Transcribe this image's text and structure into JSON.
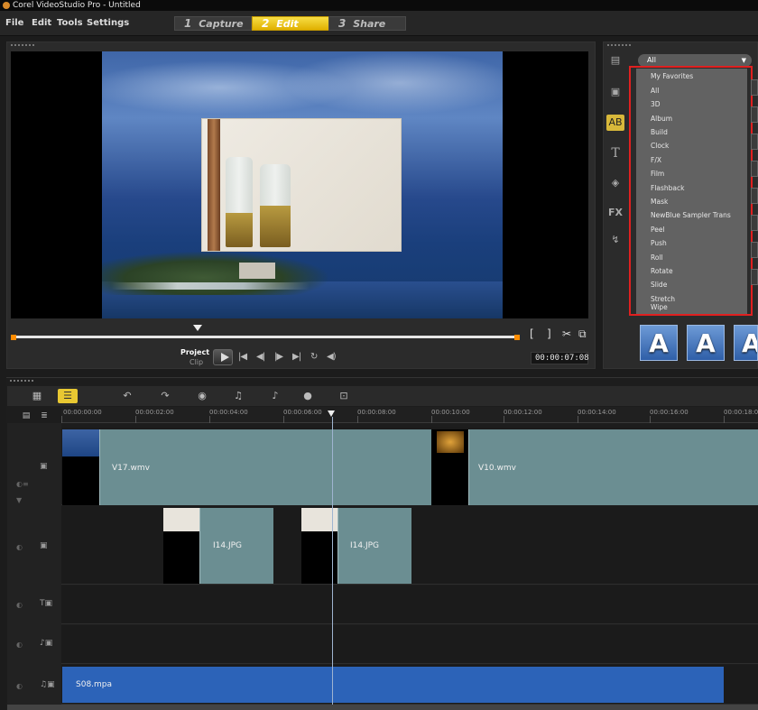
{
  "title_bar": {
    "title": "Corel VideoStudio Pro - Untitled"
  },
  "menu": [
    "File",
    "Edit",
    "Tools",
    "Settings"
  ],
  "steps": [
    {
      "num": "1",
      "label": "Capture",
      "active": false
    },
    {
      "num": "2",
      "label": "Edit",
      "active": true
    },
    {
      "num": "3",
      "label": "Share",
      "active": false
    }
  ],
  "player": {
    "project_label": "Project",
    "clip_label": "Clip",
    "timecode": "00:00:07:08",
    "mark_in": "[",
    "mark_out": "]"
  },
  "library": {
    "selected_category": "All",
    "categories": [
      "My Favorites",
      "All",
      "3D",
      "Album",
      "Build",
      "Clock",
      "F/X",
      "Film",
      "Flashback",
      "Mask",
      "NewBlue Sampler Trans",
      "Peel",
      "Push",
      "Roll",
      "Rotate",
      "Slide",
      "Stretch",
      "Wipe"
    ],
    "thumbnail_letter": "A"
  },
  "timeline": {
    "ruler_ticks": [
      "00:00:00:00",
      "00:00:02:00",
      "00:00:04:00",
      "00:00:06:00",
      "00:00:08:00",
      "00:00:10:00",
      "00:00:12:00",
      "00:00:14:00",
      "00:00:16:00",
      "00:00:18:00"
    ],
    "clips": {
      "video1": "V17.wmv",
      "video2": "V10.wmv",
      "overlay1": "I14.JPG",
      "overlay2": "I14.JPG",
      "audio1": "S08.mpa"
    }
  },
  "colors": {
    "accent": "#e8c832",
    "highlight_border": "#e02020",
    "video_clip": "#6b8e92",
    "audio_clip": "#2c63b8"
  }
}
